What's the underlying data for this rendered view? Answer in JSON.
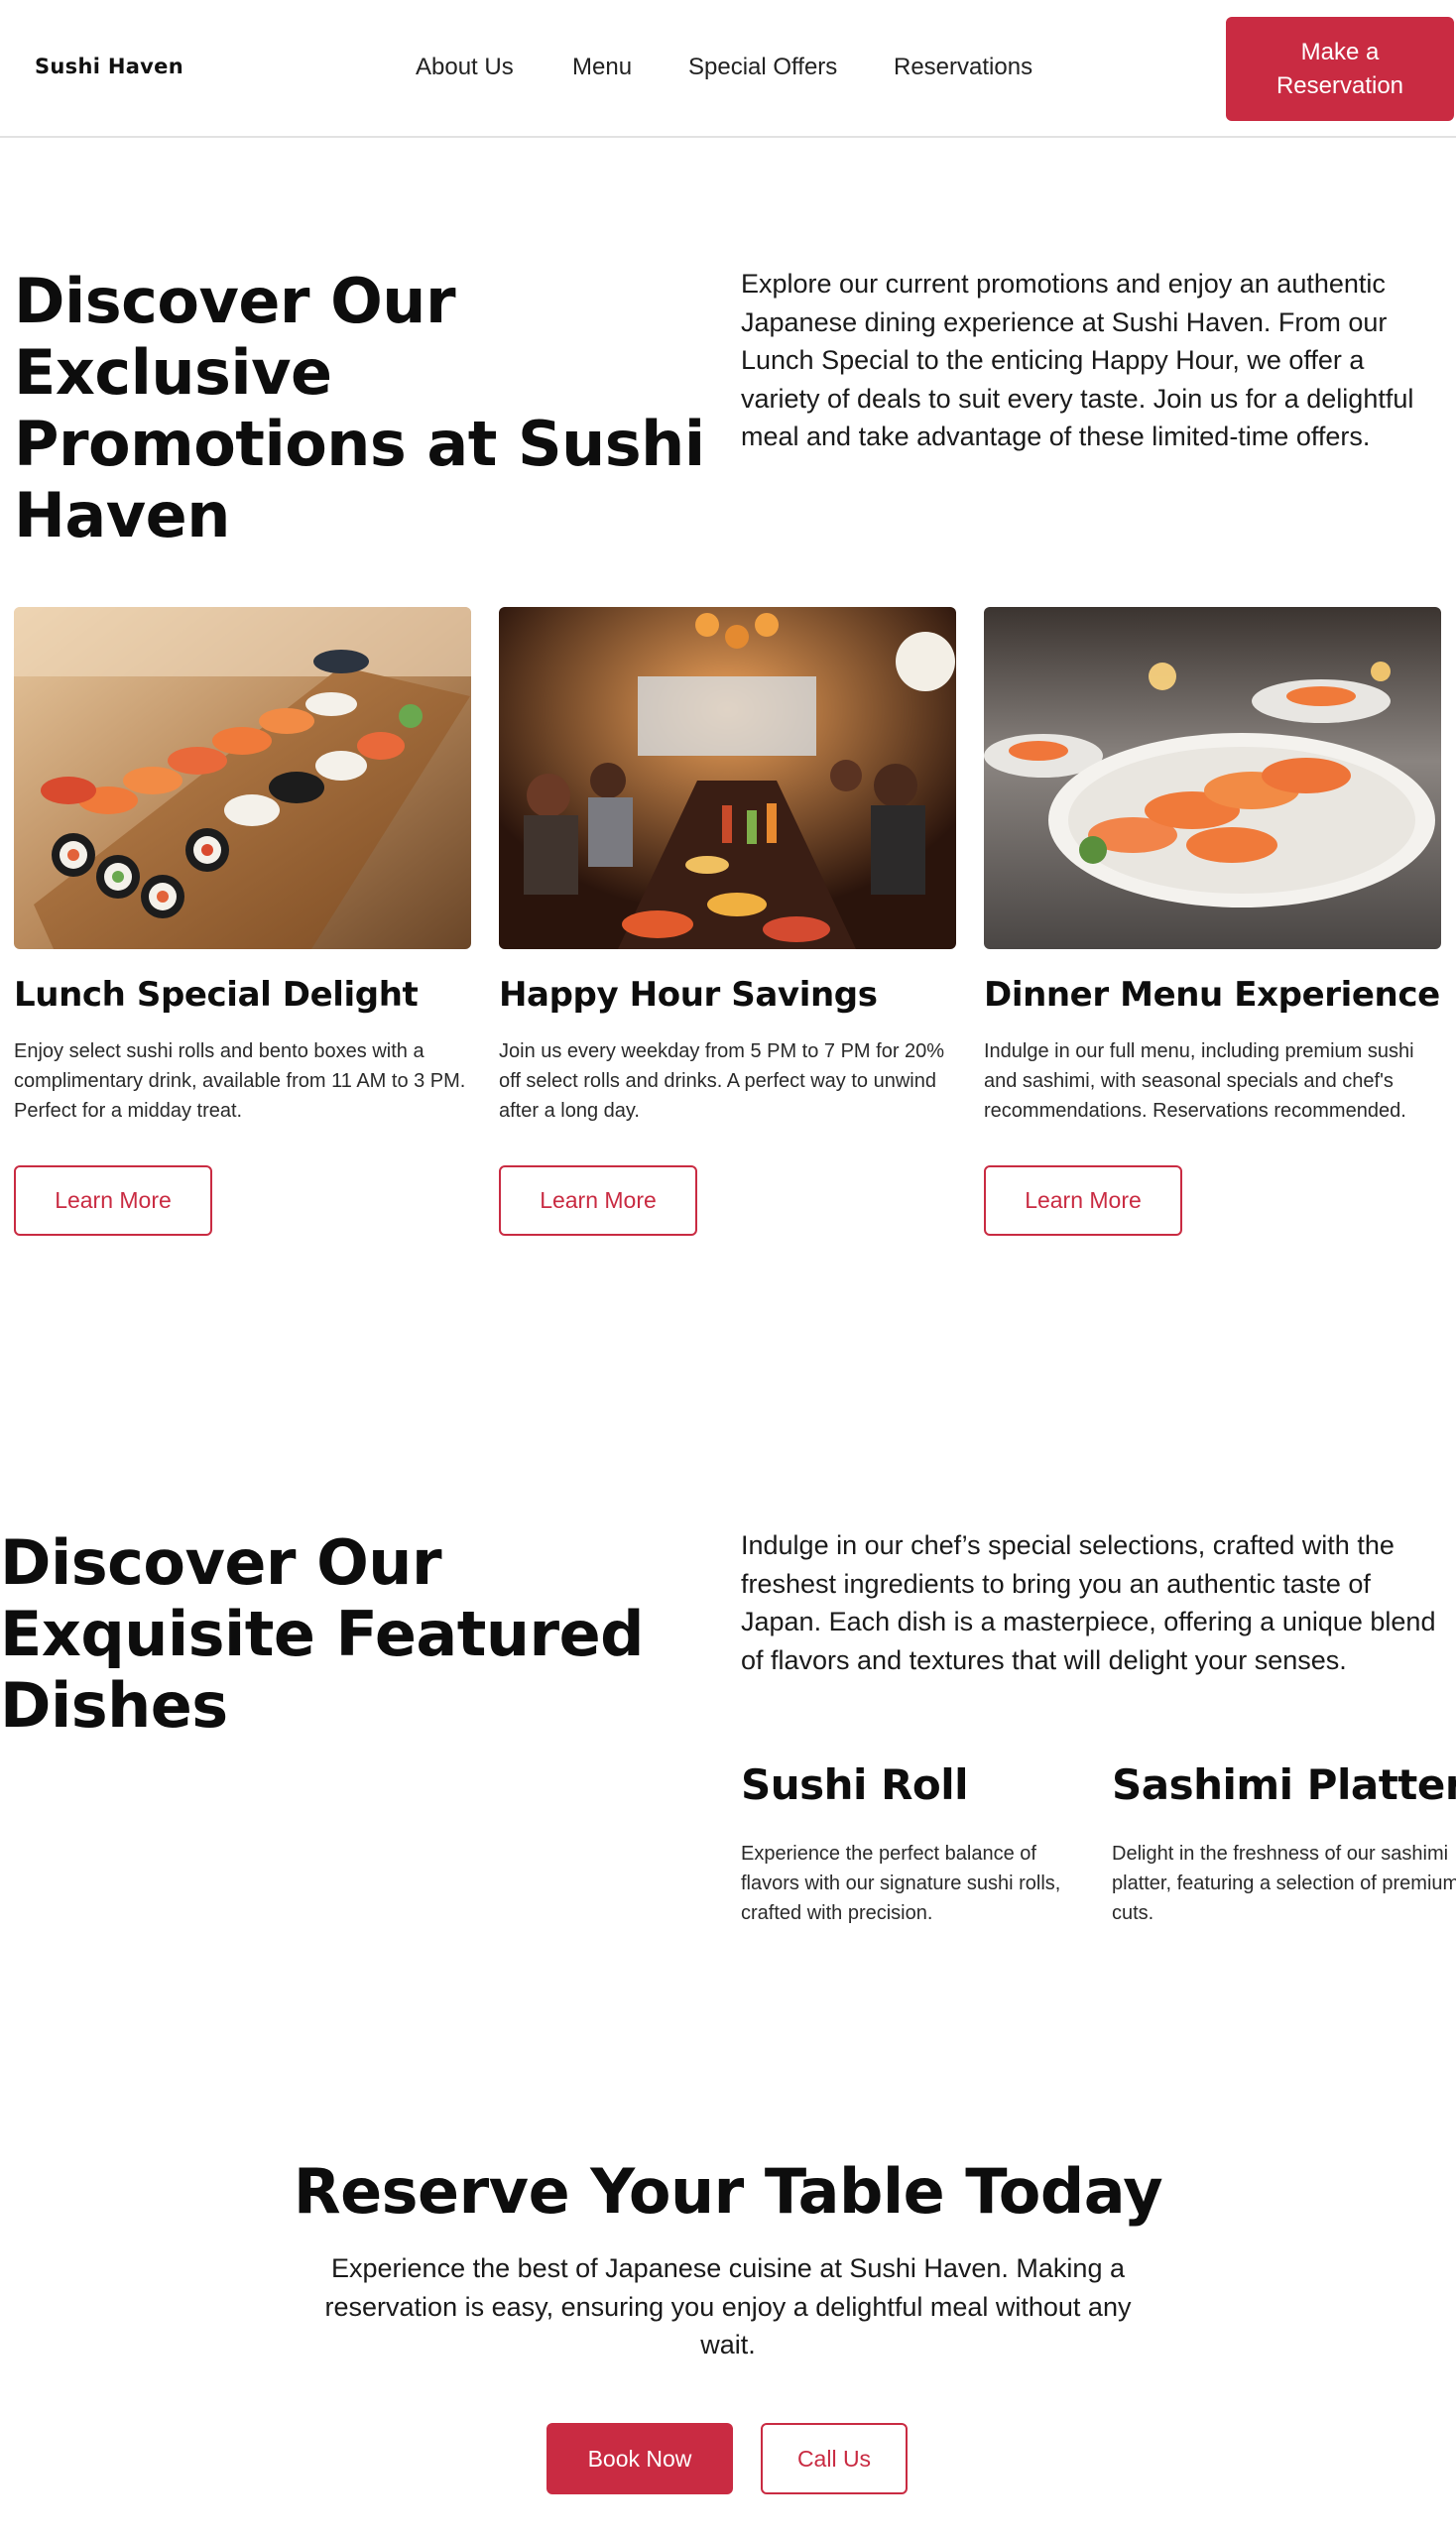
{
  "header": {
    "logo": "Sushi Haven",
    "nav": [
      "About Us",
      "Menu",
      "Special Offers",
      "Reservations"
    ],
    "cta": "Make a Reservation"
  },
  "promotions": {
    "title": "Discover Our Exclusive Promotions at Sushi Haven",
    "lead": "Explore our current promotions and enjoy an authentic Japanese dining experience at Sushi Haven. From our Lunch Special to the enticing Happy Hour, we offer a variety of deals to suit every taste. Join us for a delightful meal and take advantage of these limited-time offers.",
    "cards": [
      {
        "image": "sushi-platter-photo",
        "title": "Lunch Special Delight",
        "text": "Enjoy select sushi rolls and bento boxes with a complimentary drink, available from 11 AM to 3 PM. Perfect for a midday treat.",
        "button": "Learn More"
      },
      {
        "image": "restaurant-dining-room-photo",
        "title": "Happy Hour Savings",
        "text": "Join us every weekday from 5 PM to 7 PM for 20% off select rolls and drinks. A perfect way to unwind after a long day.",
        "button": "Learn More"
      },
      {
        "image": "salmon-nigiri-plate-photo",
        "title": "Dinner Menu Experience",
        "text": "Indulge in our full menu, including premium sushi and sashimi, with seasonal specials and chef's recommendations. Reservations recommended.",
        "button": "Learn More"
      }
    ]
  },
  "featured": {
    "title": "Discover Our Exquisite Featured Dishes",
    "lead": "Indulge in our chef’s special selections, crafted with the freshest ingredients to bring you an authentic taste of Japan. Each dish is a masterpiece, offering a unique blend of flavors and textures that will delight your senses.",
    "dishes": [
      {
        "title": "Sushi Roll",
        "text": "Experience the perfect balance of flavors with our signature sushi rolls, crafted with precision."
      },
      {
        "title": "Sashimi Platter",
        "text": "Delight in the freshness of our sashimi platter, featuring a selection of premium cuts."
      }
    ]
  },
  "reservation": {
    "title": "Reserve Your Table Today",
    "lead": "Experience the best of Japanese cuisine at Sushi Haven. Making a reservation is easy, ensuring you enjoy a delightful meal without any wait.",
    "primary_button": "Book Now",
    "secondary_button": "Call Us"
  },
  "colors": {
    "accent": "#c92b42",
    "text": "#111111",
    "background": "#ffffff"
  }
}
